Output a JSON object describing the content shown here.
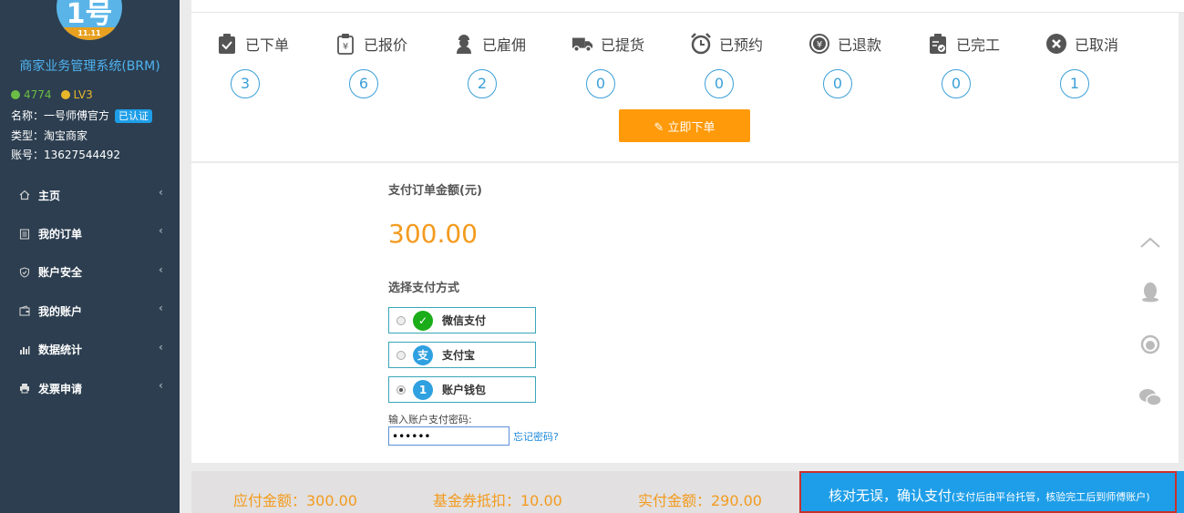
{
  "sidebar": {
    "logo": {
      "digits": "1号",
      "band": "11.11"
    },
    "system_name": "商家业务管理系统(BRM)",
    "coins": "4774",
    "level": "LV3",
    "profile": {
      "name_label": "名称：",
      "name_value": "一号师傅官方",
      "verified": "已认证",
      "type_label": "类型：",
      "type_value": "淘宝商家",
      "account_label": "账号：",
      "account_value": "13627544492"
    },
    "nav": [
      {
        "label": "主页",
        "icon": "home-icon"
      },
      {
        "label": "我的订单",
        "icon": "list-icon"
      },
      {
        "label": "账户安全",
        "icon": "shield-icon"
      },
      {
        "label": "我的账户",
        "icon": "wallet-icon"
      },
      {
        "label": "数据统计",
        "icon": "bar-chart-icon"
      },
      {
        "label": "发票申请",
        "icon": "printer-icon"
      }
    ]
  },
  "status": [
    {
      "label": "已下单",
      "count": "3",
      "icon": "clipboard-check-icon"
    },
    {
      "label": "已报价",
      "count": "6",
      "icon": "yen-clipboard-icon"
    },
    {
      "label": "已雇佣",
      "count": "2",
      "icon": "worker-icon"
    },
    {
      "label": "已提货",
      "count": "0",
      "icon": "truck-icon"
    },
    {
      "label": "已预约",
      "count": "0",
      "icon": "alarm-clock-icon"
    },
    {
      "label": "已退款",
      "count": "0",
      "icon": "refund-icon"
    },
    {
      "label": "已完工",
      "count": "0",
      "icon": "clipboard-done-icon"
    },
    {
      "label": "已取消",
      "count": "1",
      "icon": "cancel-icon"
    }
  ],
  "order_now": "立即下单",
  "payment": {
    "title": "支付订单金额(元)",
    "amount": "300.00",
    "method_title": "选择支付方式",
    "methods": [
      {
        "label": "微信支付",
        "icon": "wechat-pay-icon",
        "color": "#1aad19",
        "selected": false
      },
      {
        "label": "支付宝",
        "icon": "alipay-icon",
        "color": "#2fa0e0",
        "selected": false
      },
      {
        "label": "账户钱包",
        "icon": "wallet-logo-icon",
        "color": "#2fa0e0",
        "selected": true
      }
    ],
    "password_label": "输入账户支付密码:",
    "password_value": "••••••",
    "forgot": "忘记密码?"
  },
  "summary": {
    "payable": "应付金额：300.00",
    "voucher": "基金券抵扣：10.00",
    "actual": "实付金额：290.00"
  },
  "confirm": {
    "main": "核对无误，确认支付",
    "sub": "(支付后由平台托管，核验完工后到师傅账户)"
  },
  "colors": {
    "sidebar": "#2c3e50",
    "accent_orange": "#ff9a0a",
    "amount_orange": "#f39b1e",
    "blue": "#1e9ee8"
  }
}
